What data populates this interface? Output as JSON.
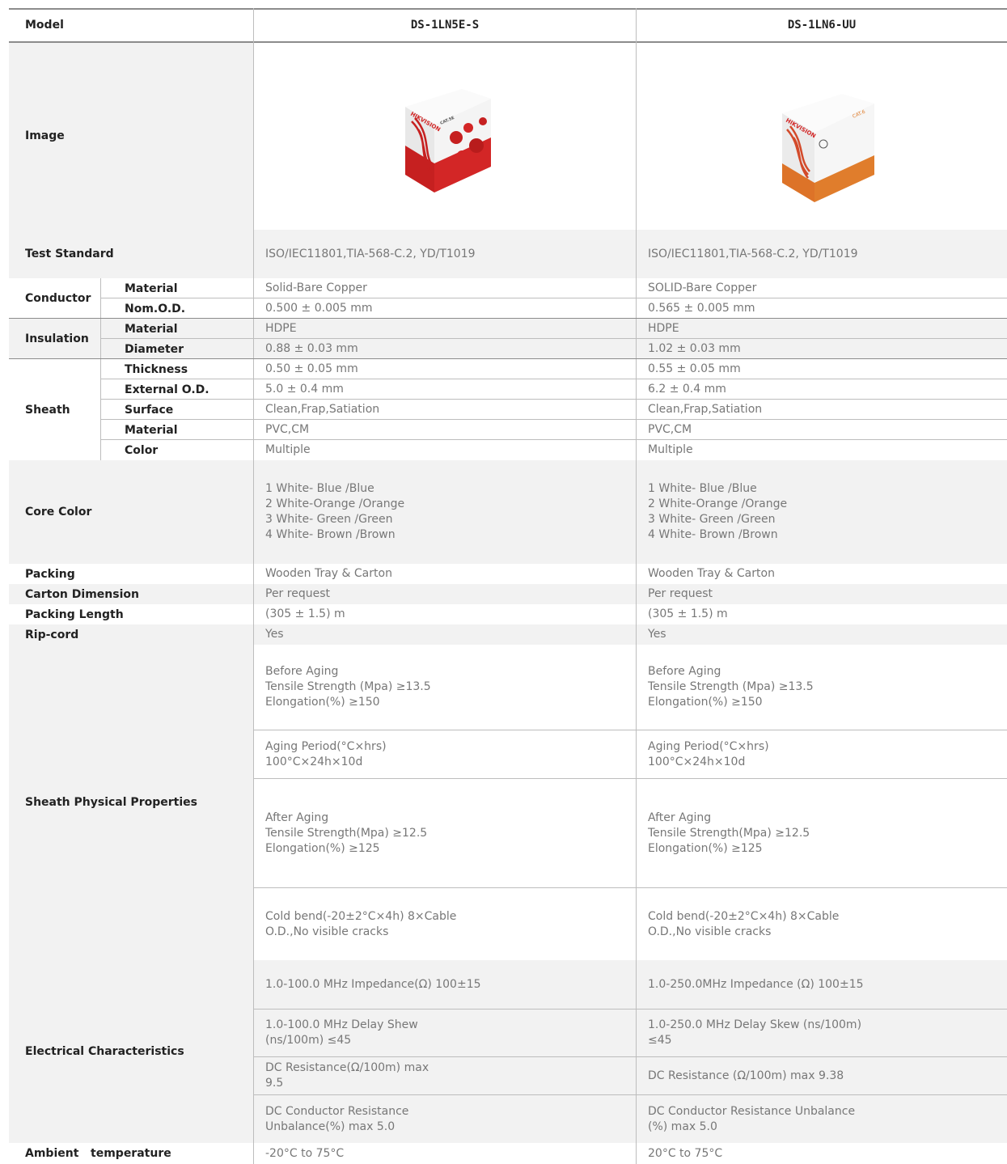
{
  "header": {
    "model_label": "Model",
    "col1": "DS-1LN5E-S",
    "col2": "DS-1LN6-UU"
  },
  "image_row": {
    "label": "Image",
    "box1": {
      "brand": "HIKVISION",
      "cat": "CAT.5E",
      "accent": "#d32626"
    },
    "box2": {
      "brand": "HIKVISION",
      "cat": "CAT.6",
      "accent": "#e07d2c"
    }
  },
  "rows": {
    "test_standard": {
      "label": "Test Standard",
      "v1": "ISO/IEC11801,TIA-568-C.2, YD/T1019",
      "v2": "ISO/IEC11801,TIA-568-C.2, YD/T1019"
    },
    "conductor": {
      "label": "Conductor",
      "material": {
        "label": "Material",
        "v1": "Solid-Bare Copper",
        "v2": "SOLID-Bare Copper"
      },
      "nomod": {
        "label": "Nom.O.D.",
        "v1": "0.500 ± 0.005 mm",
        "v2": "0.565 ± 0.005 mm"
      }
    },
    "insulation": {
      "label": "Insulation",
      "material": {
        "label": "Material",
        "v1": "HDPE",
        "v2": "HDPE"
      },
      "diameter": {
        "label": "Diameter",
        "v1": "0.88 ± 0.03 mm",
        "v2": "1.02 ± 0.03 mm"
      }
    },
    "sheath": {
      "label": "Sheath",
      "thickness": {
        "label": "Thickness",
        "v1": "0.50 ± 0.05 mm",
        "v2": "0.55 ± 0.05 mm"
      },
      "external": {
        "label": "External O.D.",
        "v1": "5.0 ± 0.4 mm",
        "v2": "6.2 ± 0.4 mm"
      },
      "surface": {
        "label": "Surface",
        "v1": "Clean,Frap,Satiation",
        "v2": "Clean,Frap,Satiation"
      },
      "material": {
        "label": "Material",
        "v1": "PVC,CM",
        "v2": "PVC,CM"
      },
      "color": {
        "label": "Color",
        "v1": "Multiple",
        "v2": "Multiple"
      }
    },
    "core_color": {
      "label": "Core Color",
      "v1": "1 White- Blue /Blue\n2 White-Orange /Orange\n3 White- Green /Green\n4 White- Brown /Brown",
      "v2": "1 White- Blue /Blue\n2 White-Orange /Orange\n3 White- Green /Green\n4 White- Brown /Brown"
    },
    "packing": {
      "label": "Packing",
      "v1": "Wooden Tray & Carton",
      "v2": "Wooden Tray & Carton"
    },
    "carton": {
      "label": "Carton Dimension",
      "v1": "Per request",
      "v2": "Per request"
    },
    "length": {
      "label": "Packing Length",
      "v1": "(305 ± 1.5) m",
      "v2": "(305 ± 1.5) m"
    },
    "ripcord": {
      "label": "Rip-cord",
      "v1": "Yes",
      "v2": "Yes"
    },
    "sheath_phys": {
      "label": "Sheath Physical Properties",
      "before": {
        "v1": "Before Aging\nTensile Strength (Mpa) ≥13.5\nElongation(%) ≥150",
        "v2": "Before Aging\nTensile Strength (Mpa) ≥13.5\nElongation(%) ≥150"
      },
      "period": {
        "v1": "Aging Period(°C×hrs)\n100°C×24h×10d",
        "v2": "Aging Period(°C×hrs)\n100°C×24h×10d"
      },
      "after": {
        "v1": "After Aging\nTensile Strength(Mpa) ≥12.5\nElongation(%) ≥125",
        "v2": "After Aging\nTensile Strength(Mpa) ≥12.5\nElongation(%) ≥125"
      },
      "cold": {
        "v1": "Cold bend(-20±2°C×4h) 8×Cable\nO.D.,No visible cracks",
        "v2": "Cold bend(-20±2°C×4h) 8×Cable\nO.D.,No visible cracks"
      }
    },
    "electrical": {
      "label": "Electrical Characteristics",
      "impedance": {
        "v1": "1.0-100.0 MHz Impedance(Ω) 100±15",
        "v2": "1.0-250.0MHz Impedance (Ω) 100±15"
      },
      "delay": {
        "v1": "1.0-100.0 MHz Delay Shew\n(ns/100m) ≤45",
        "v2": "1.0-250.0 MHz Delay Skew (ns/100m)\n≤45"
      },
      "dcres": {
        "v1": "DC Resistance(Ω/100m) max\n9.5",
        "v2": "DC Resistance (Ω/100m) max 9.38"
      },
      "unbalance": {
        "v1": "DC Conductor Resistance\nUnbalance(%) max 5.0",
        "v2": "DC Conductor Resistance Unbalance\n(%) max 5.0"
      }
    },
    "ambient": {
      "label": "Ambient   temperature",
      "v1": "-20°C to 75°C",
      "v2": "20°C to 75°C"
    }
  }
}
